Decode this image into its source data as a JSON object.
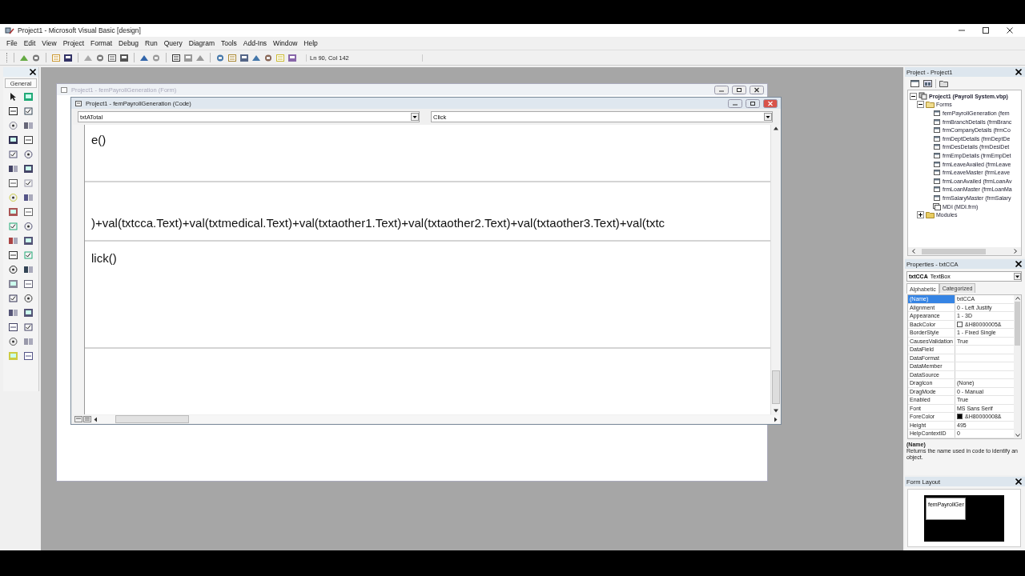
{
  "window": {
    "title": "Project1 - Microsoft Visual Basic [design]"
  },
  "menu": [
    "File",
    "Edit",
    "View",
    "Project",
    "Format",
    "Debug",
    "Run",
    "Query",
    "Diagram",
    "Tools",
    "Add-Ins",
    "Window",
    "Help"
  ],
  "toolbar": {
    "position": "Ln 90, Col 142"
  },
  "toolbox": {
    "tab": "General"
  },
  "form_window": {
    "title": "Project1 - femPayrollGeneration (Form)"
  },
  "code_window": {
    "title": "Project1 - femPayrollGeneration (Code)",
    "object": "txtATotal",
    "procedure": "Click",
    "lines": [
      {
        "kind": "code",
        "text": "e()"
      },
      {
        "kind": "blank"
      },
      {
        "kind": "separator"
      },
      {
        "kind": "blank"
      },
      {
        "kind": "code",
        "text": ")+val(txtcca.Text)+val(txtmedical.Text)+val(txtaother1.Text)+val(txtaother2.Text)+val(txtaother3.Text)+val(txtc"
      },
      {
        "kind": "separator"
      },
      {
        "kind": "code",
        "text": "lick()"
      },
      {
        "kind": "blank"
      },
      {
        "kind": "blank"
      },
      {
        "kind": "blank"
      },
      {
        "kind": "separator"
      }
    ]
  },
  "project": {
    "title": "Project - Project1",
    "tree": [
      {
        "label": "Project1 (Payroll System.vbp)",
        "kind": "project",
        "expanded": true,
        "children": [
          {
            "label": "Forms",
            "kind": "folder",
            "expanded": true,
            "children": [
              {
                "label": "femPayrollGeneration (fem",
                "kind": "form"
              },
              {
                "label": "frmBranchDetails (frmBranc",
                "kind": "form"
              },
              {
                "label": "frmCompanyDetails (frmCo",
                "kind": "form"
              },
              {
                "label": "frmDeptDetails (frmDeptDe",
                "kind": "form"
              },
              {
                "label": "frmDesDetails (frmDesiDet",
                "kind": "form"
              },
              {
                "label": "frmEmpDetails (frmEmpDet",
                "kind": "form"
              },
              {
                "label": "frmLeaveAvailed (frmLeave",
                "kind": "form"
              },
              {
                "label": "frmLeaveMaster (frmLeave",
                "kind": "form"
              },
              {
                "label": "frmLoanAvailed (frmLoanAv",
                "kind": "form"
              },
              {
                "label": "frmLoanMaster (frmLoanMa",
                "kind": "form"
              },
              {
                "label": "frmSalaryMaster (frmSalary",
                "kind": "form"
              },
              {
                "label": "MDI (MDI.frm)",
                "kind": "mdi"
              }
            ]
          },
          {
            "label": "Modules",
            "kind": "folder",
            "expanded": false
          }
        ]
      }
    ]
  },
  "properties": {
    "title": "Properties - txtCCA",
    "object_name": "txtCCA",
    "object_type": "TextBox",
    "tabs": [
      {
        "label": "Alphabetic",
        "selected": true
      },
      {
        "label": "Categorized",
        "selected": false
      }
    ],
    "rows": [
      {
        "name": "(Name)",
        "value": "txtCCA",
        "selected": true
      },
      {
        "name": "Alignment",
        "value": "0 - Left Justify",
        "selected": false
      },
      {
        "name": "Appearance",
        "value": "1 - 3D",
        "selected": false
      },
      {
        "name": "BackColor",
        "value": "&H80000005&",
        "color": "#ffffff",
        "selected": false
      },
      {
        "name": "BorderStyle",
        "value": "1 - Fixed Single",
        "selected": false
      },
      {
        "name": "CausesValidation",
        "value": "True",
        "selected": false
      },
      {
        "name": "DataField",
        "selected": false
      },
      {
        "name": "DataFormat",
        "selected": false
      },
      {
        "name": "DataMember",
        "selected": false
      },
      {
        "name": "DataSource",
        "selected": false
      },
      {
        "name": "DragIcon",
        "value": "(None)",
        "selected": false
      },
      {
        "name": "DragMode",
        "value": "0 - Manual",
        "selected": false
      },
      {
        "name": "Enabled",
        "value": "True",
        "selected": false
      },
      {
        "name": "Font",
        "value": "MS Sans Serif",
        "selected": false
      },
      {
        "name": "ForeColor",
        "value": "&H80000008&",
        "color": "#000000",
        "selected": false
      },
      {
        "name": "Height",
        "value": "495",
        "selected": false
      },
      {
        "name": "HelpContextID",
        "value": "0",
        "selected": false
      }
    ],
    "description_title": "(Name)",
    "description": "Returns the name used in code to identify an object."
  },
  "form_layout": {
    "title": "Form Layout",
    "form_label": "femPayrollGer"
  }
}
